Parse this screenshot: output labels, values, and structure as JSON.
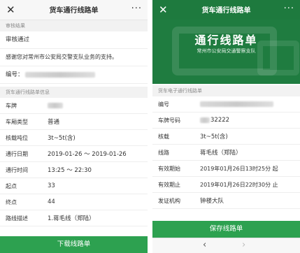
{
  "left": {
    "nav": {
      "close": "✕",
      "title": "货车通行线路单",
      "more": "···"
    },
    "section1": "审核结果",
    "status": "审核通过",
    "thanks": "感谢您对常州市公安局交警支队业务的支持。",
    "number_label": "编号：",
    "section2": "货车通行线路单信息",
    "rows": [
      {
        "label": "车牌",
        "value": ""
      },
      {
        "label": "车厢类型",
        "value": "普通"
      },
      {
        "label": "核载吨位",
        "value": "3t~5t(含)"
      },
      {
        "label": "通行日期",
        "value": "2019-01-26 ～ 2019-01-26"
      },
      {
        "label": "通行时间",
        "value": "13:25 ～ 22:30"
      },
      {
        "label": "起点",
        "value": "33"
      },
      {
        "label": "终点",
        "value": "44"
      }
    ],
    "partial_row": {
      "label": "路线描述",
      "value": "1.蒋毛线（郑陆）"
    },
    "button": "下载线路单"
  },
  "right": {
    "nav": {
      "close": "✕",
      "title": "货车通行线路单",
      "more": "···"
    },
    "banner_title": "通行线路单",
    "banner_sub": "常州市公安局交通警察支队",
    "section": "货车电子通行线路单",
    "rows": [
      {
        "label": "编号",
        "value": ""
      },
      {
        "label": "车牌号码",
        "value": "32222"
      },
      {
        "label": "核载",
        "value": "3t~5t(含)"
      },
      {
        "label": "线路",
        "value": "蒋毛线（郑陆）"
      },
      {
        "label": "有效期始",
        "value": "2019年01月26日13时25分 起"
      },
      {
        "label": "有效期止",
        "value": "2019年01月26日22时30分 止"
      },
      {
        "label": "发证机构",
        "value": "钟楼大队"
      }
    ],
    "button": "保存线路单",
    "back": "‹",
    "forward": "›"
  }
}
